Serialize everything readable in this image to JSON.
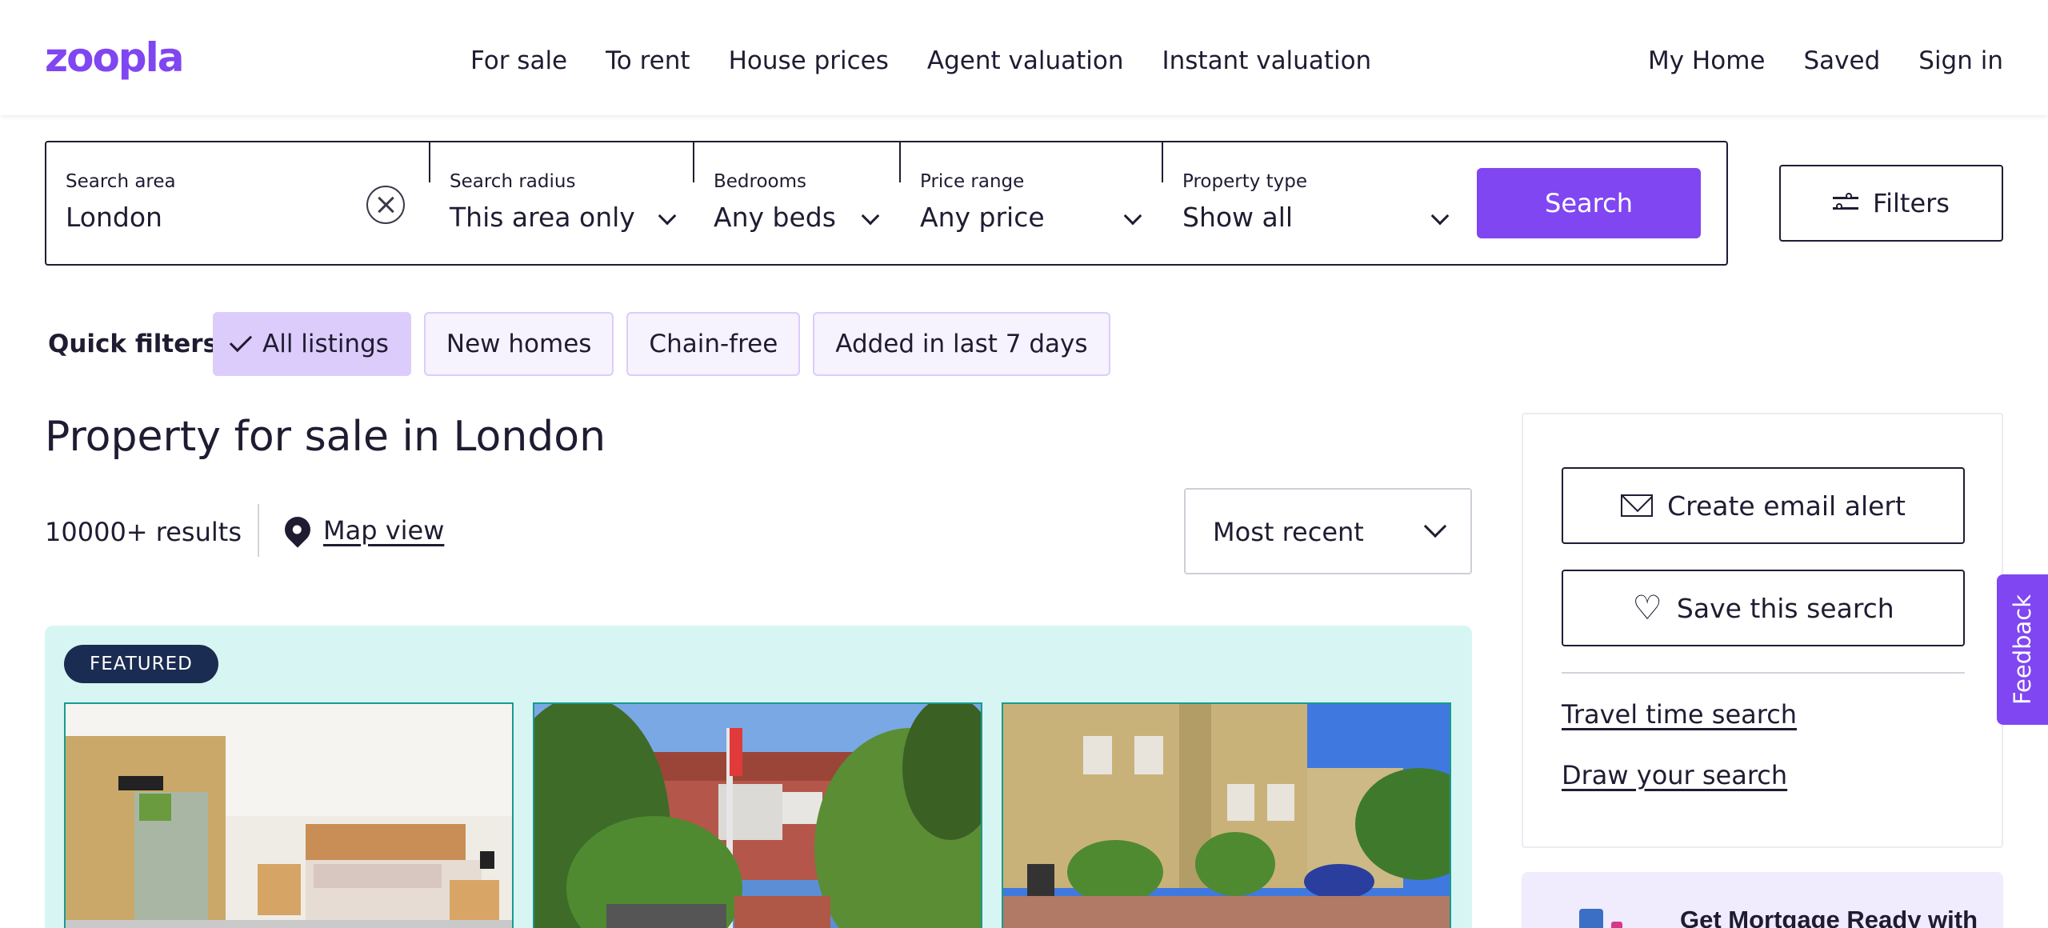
{
  "header": {
    "logo": "zoopla",
    "nav": [
      "For sale",
      "To rent",
      "House prices",
      "Agent valuation",
      "Instant valuation"
    ],
    "nav_right": [
      "My Home",
      "Saved",
      "Sign in"
    ]
  },
  "search": {
    "area_label": "Search area",
    "area_value": "London",
    "radius_label": "Search radius",
    "radius_value": "This area only",
    "beds_label": "Bedrooms",
    "beds_value": "Any beds",
    "price_label": "Price range",
    "price_value": "Any price",
    "type_label": "Property type",
    "type_value": "Show all",
    "button": "Search",
    "filters_button": "Filters"
  },
  "quick_filters": {
    "label": "Quick filters",
    "chips": [
      "All listings",
      "New homes",
      "Chain-free",
      "Added in last 7 days"
    ],
    "active": "All listings"
  },
  "main": {
    "title": "Property for sale in London",
    "results": "10000+ results",
    "map_view": "Map view",
    "sort_value": "Most recent"
  },
  "featured": {
    "badge": "FEATURED"
  },
  "sidebar": {
    "email_alert": "Create email alert",
    "save_search": "Save this search",
    "travel_time": "Travel time search",
    "draw_search": "Draw your search",
    "promo": "Get Mortgage Ready with"
  },
  "feedback": "Feedback",
  "colors": {
    "brand": "#8046f1",
    "featured_bg": "#d7f6f3",
    "badge": "#1b2c52"
  },
  "icons": [
    "clear-icon",
    "chevron-down-icon",
    "filters-icon",
    "check-icon",
    "map-pin-icon",
    "mail-icon",
    "heart-icon"
  ]
}
